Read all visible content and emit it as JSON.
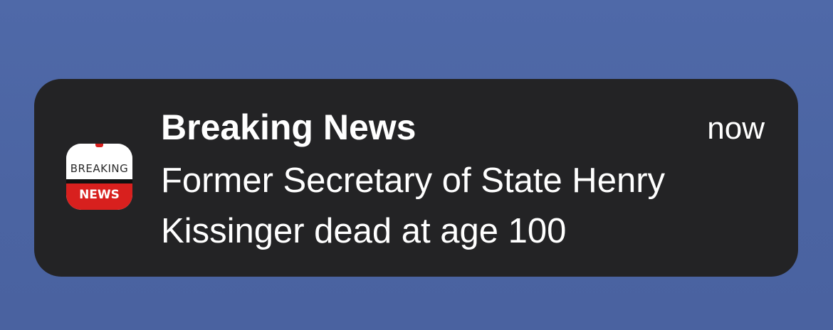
{
  "notification": {
    "app_icon": {
      "icon_name": "breaking-news-app-icon",
      "top_word": "BREAKING",
      "bottom_word": "NEWS",
      "accent_color": "#d8201e"
    },
    "title": "Breaking News",
    "time": "now",
    "message": "Former Secretary of State Henry Kissinger dead at age 100"
  },
  "colors": {
    "background": "#4b64a2",
    "card": "#232325",
    "text": "#ffffff"
  }
}
